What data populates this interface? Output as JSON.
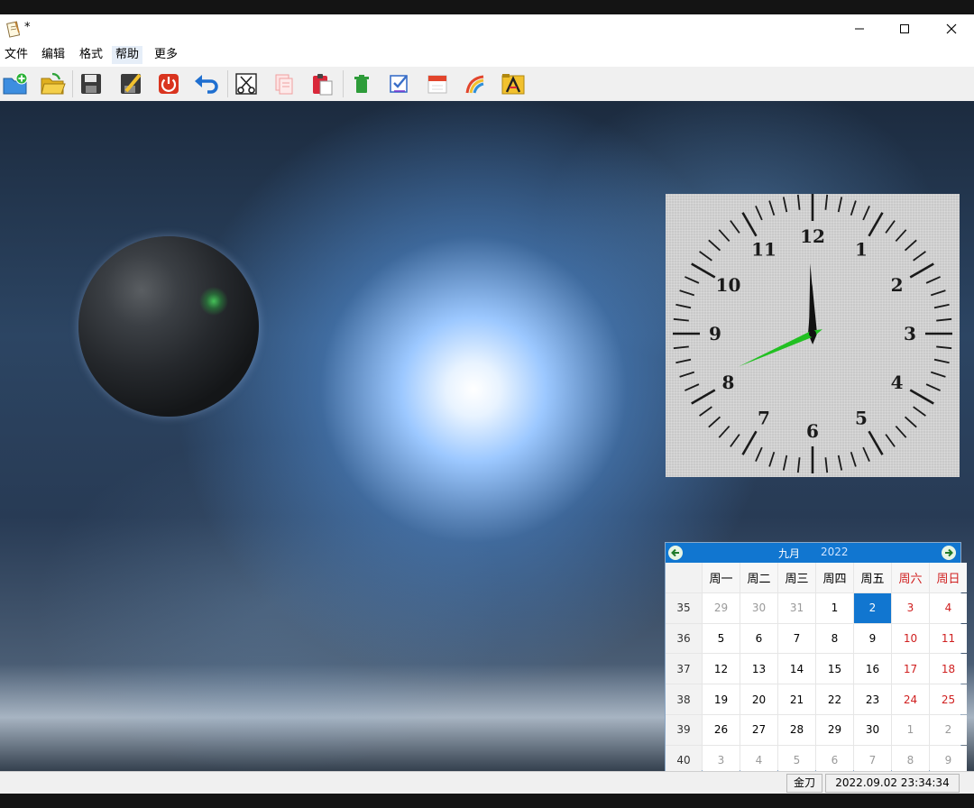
{
  "window": {
    "title": "*"
  },
  "menu": [
    "文件",
    "编辑",
    "格式",
    "帮助",
    "更多"
  ],
  "toolbar": [
    "new-folder-icon",
    "open-folder-icon",
    "save-icon",
    "edit-save-icon",
    "power-icon",
    "undo-icon",
    "cut-icon",
    "copy-icon",
    "paste-icon",
    "delete-icon",
    "checkbox-icon",
    "calendar-icon",
    "color-icon",
    "font-icon"
  ],
  "clock": {
    "numbers": [
      "12",
      "1",
      "2",
      "3",
      "4",
      "5",
      "6",
      "7",
      "8",
      "9",
      "10",
      "11"
    ],
    "time": {
      "hour": 11,
      "minute": 59,
      "second": 41
    }
  },
  "calendar": {
    "month": "九月",
    "year": "2022",
    "weekdays": [
      "周一",
      "周二",
      "周三",
      "周四",
      "周五",
      "周六",
      "周日"
    ],
    "weeks": [
      {
        "no": "35",
        "days": [
          {
            "d": "29",
            "o": true
          },
          {
            "d": "30",
            "o": true
          },
          {
            "d": "31",
            "o": true
          },
          {
            "d": "1"
          },
          {
            "d": "2",
            "sel": true
          },
          {
            "d": "3"
          },
          {
            "d": "4"
          }
        ]
      },
      {
        "no": "36",
        "days": [
          {
            "d": "5"
          },
          {
            "d": "6"
          },
          {
            "d": "7"
          },
          {
            "d": "8"
          },
          {
            "d": "9"
          },
          {
            "d": "10"
          },
          {
            "d": "11"
          }
        ]
      },
      {
        "no": "37",
        "days": [
          {
            "d": "12"
          },
          {
            "d": "13"
          },
          {
            "d": "14"
          },
          {
            "d": "15"
          },
          {
            "d": "16"
          },
          {
            "d": "17"
          },
          {
            "d": "18"
          }
        ]
      },
      {
        "no": "38",
        "days": [
          {
            "d": "19"
          },
          {
            "d": "20"
          },
          {
            "d": "21"
          },
          {
            "d": "22"
          },
          {
            "d": "23"
          },
          {
            "d": "24"
          },
          {
            "d": "25"
          }
        ]
      },
      {
        "no": "39",
        "days": [
          {
            "d": "26"
          },
          {
            "d": "27"
          },
          {
            "d": "28"
          },
          {
            "d": "29"
          },
          {
            "d": "30"
          },
          {
            "d": "1",
            "o": true
          },
          {
            "d": "2",
            "o": true
          }
        ]
      },
      {
        "no": "40",
        "days": [
          {
            "d": "3",
            "o": true
          },
          {
            "d": "4",
            "o": true
          },
          {
            "d": "5",
            "o": true
          },
          {
            "d": "6",
            "o": true
          },
          {
            "d": "7",
            "o": true
          },
          {
            "d": "8",
            "o": true
          },
          {
            "d": "9",
            "o": true
          }
        ]
      }
    ]
  },
  "status": {
    "user": "金刀",
    "datetime": "2022.09.02 23:34:34"
  },
  "colors": {
    "accent": "#1176d0",
    "weekend": "#d02020",
    "second_hand": "#22c022"
  }
}
